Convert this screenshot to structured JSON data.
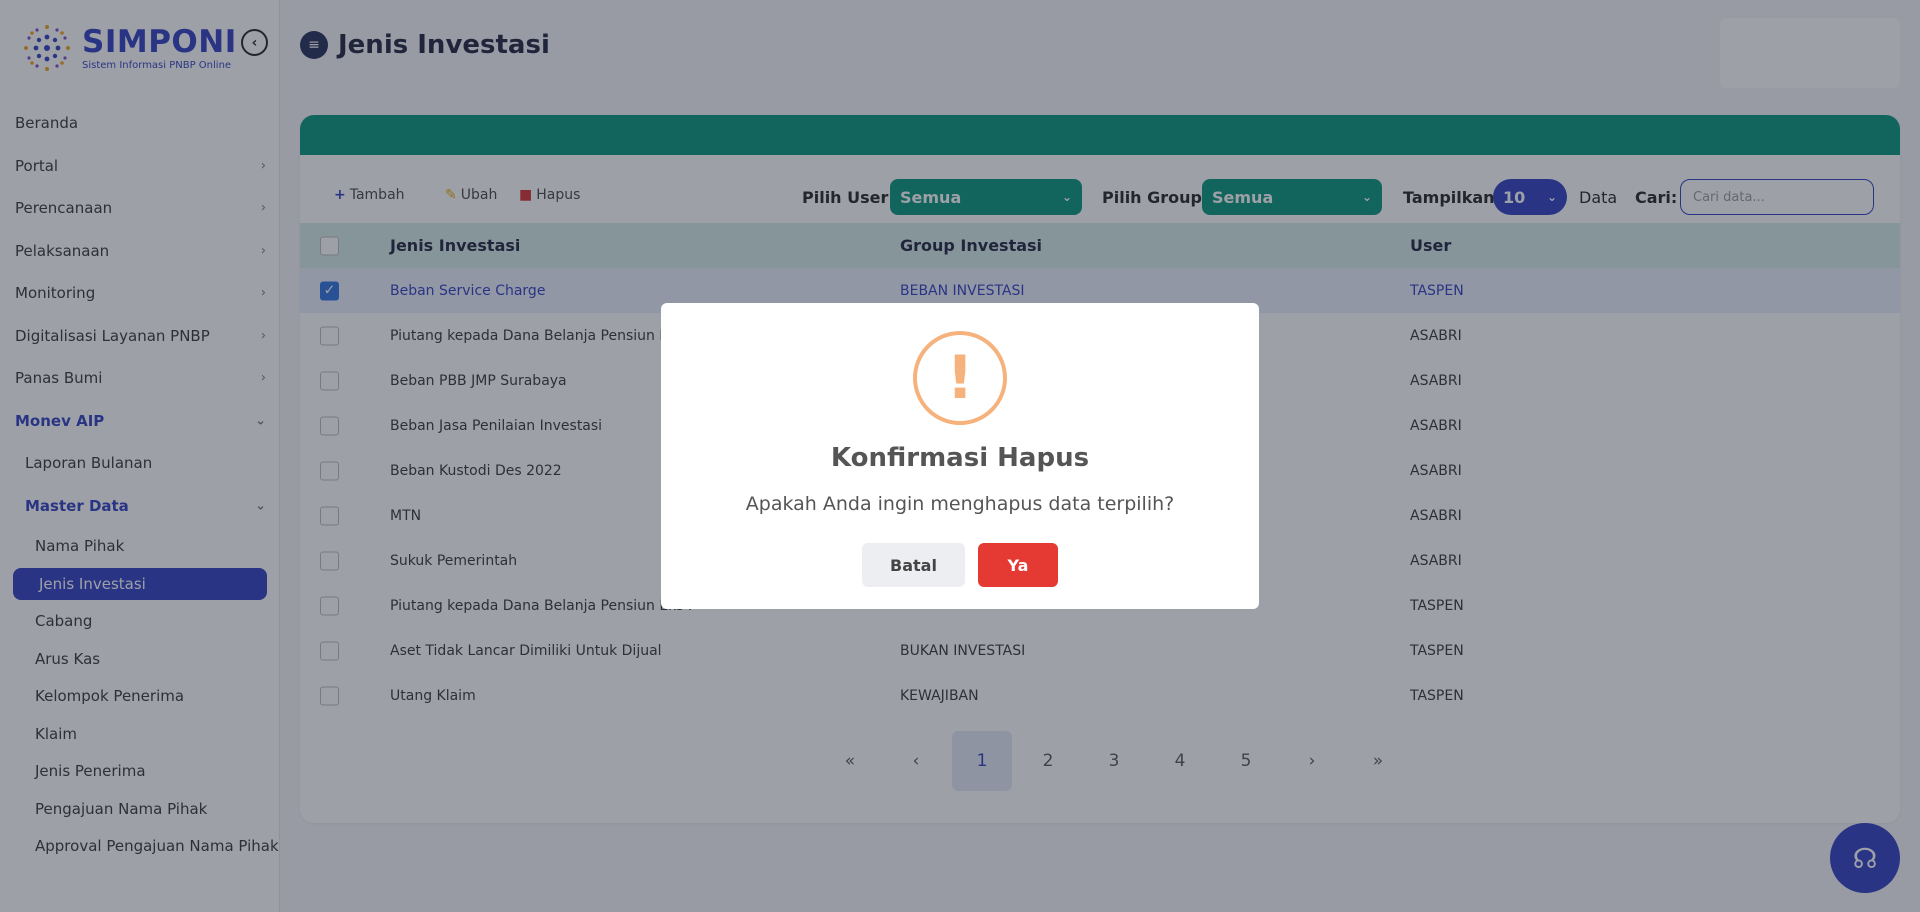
{
  "app": {
    "logo_title": "SIMPONI",
    "logo_subtitle": "Sistem Informasi PNBP Online"
  },
  "sidebar": {
    "items": [
      {
        "label": "Beranda",
        "chevron": false
      },
      {
        "label": "Portal",
        "chevron": true
      },
      {
        "label": "Perencanaan",
        "chevron": true
      },
      {
        "label": "Pelaksanaan",
        "chevron": true
      },
      {
        "label": "Monitoring",
        "chevron": true
      },
      {
        "label": "Digitalisasi Layanan PNBP",
        "chevron": true
      },
      {
        "label": "Panas Bumi",
        "chevron": true
      },
      {
        "label": "Monev AIP",
        "chevron": true
      },
      {
        "label": "Laporan Bulanan"
      },
      {
        "label": "Master Data"
      },
      {
        "label": "Nama Pihak"
      },
      {
        "label": "Jenis Investasi"
      },
      {
        "label": "Cabang"
      },
      {
        "label": "Arus Kas"
      },
      {
        "label": "Kelompok Penerima"
      },
      {
        "label": "Klaim"
      },
      {
        "label": "Jenis Penerima"
      },
      {
        "label": "Pengajuan Nama Pihak"
      },
      {
        "label": "Approval Pengajuan Nama Pihak"
      }
    ]
  },
  "page": {
    "title": "Jenis Investasi"
  },
  "toolbar": {
    "add_label": "Tambah",
    "edit_label": "Ubah",
    "delete_label": "Hapus",
    "user_label": "Pilih User:",
    "user_value": "Semua",
    "group_label": "Pilih Group:",
    "group_value": "Semua",
    "show_label": "Tampilkan",
    "show_value": "10",
    "data_label": "Data",
    "search_label": "Cari:",
    "search_placeholder": "Cari data..."
  },
  "table": {
    "headers": [
      "Jenis Investasi",
      "Group Investasi",
      "User"
    ],
    "rows": [
      {
        "jenis": "Beban Service Charge",
        "group": "BEBAN INVESTASI",
        "user": "TASPEN",
        "checked": true
      },
      {
        "jenis": "Piutang kepada Dana Belanja Pensiun Eks F",
        "group": "",
        "user": "ASABRI",
        "checked": false
      },
      {
        "jenis": "Beban PBB JMP Surabaya",
        "group": "",
        "user": "ASABRI",
        "checked": false
      },
      {
        "jenis": "Beban Jasa Penilaian Investasi",
        "group": "",
        "user": "ASABRI",
        "checked": false
      },
      {
        "jenis": "Beban Kustodi Des 2022",
        "group": "",
        "user": "ASABRI",
        "checked": false
      },
      {
        "jenis": "MTN",
        "group": "",
        "user": "ASABRI",
        "checked": false
      },
      {
        "jenis": "Sukuk Pemerintah",
        "group": "",
        "user": "ASABRI",
        "checked": false
      },
      {
        "jenis": "Piutang kepada Dana Belanja Pensiun Eks P",
        "group": "",
        "user": "TASPEN",
        "checked": false
      },
      {
        "jenis": "Aset Tidak Lancar Dimiliki Untuk Dijual",
        "group": "BUKAN INVESTASI",
        "user": "TASPEN",
        "checked": false
      },
      {
        "jenis": "Utang Klaim",
        "group": "KEWAJIBAN",
        "user": "TASPEN",
        "checked": false
      }
    ]
  },
  "pagination": {
    "first": "«",
    "prev": "‹",
    "pages": [
      "1",
      "2",
      "3",
      "4",
      "5"
    ],
    "current": "1",
    "next": "›",
    "last": "»"
  },
  "modal": {
    "icon": "!",
    "title": "Konfirmasi Hapus",
    "message": "Apakah Anda ingin menghapus data terpilih?",
    "cancel_label": "Batal",
    "confirm_label": "Ya"
  },
  "colors": {
    "primary": "#2b3cbf",
    "teal": "#009478",
    "danger": "#e53a33",
    "warning": "#f5b27c"
  }
}
